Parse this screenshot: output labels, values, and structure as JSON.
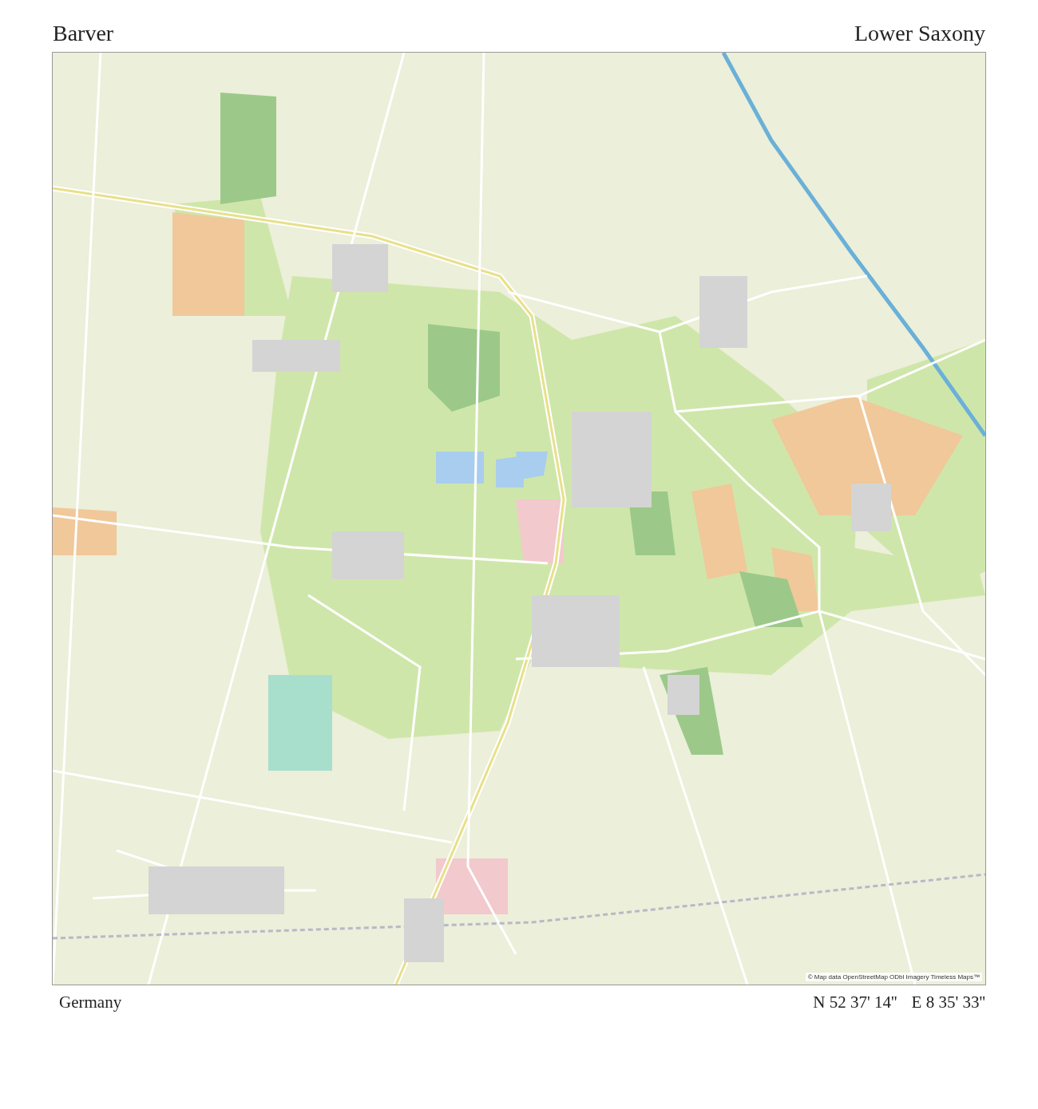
{
  "title": "Barver",
  "region": "Lower Saxony",
  "country": "Germany",
  "coordinates": {
    "latitude": "N 52 37' 14''",
    "longitude": "E 8 35' 33''"
  },
  "map": {
    "attribution": "© Map data OpenStreetMap ODbl Imagery Timeless Maps™"
  }
}
